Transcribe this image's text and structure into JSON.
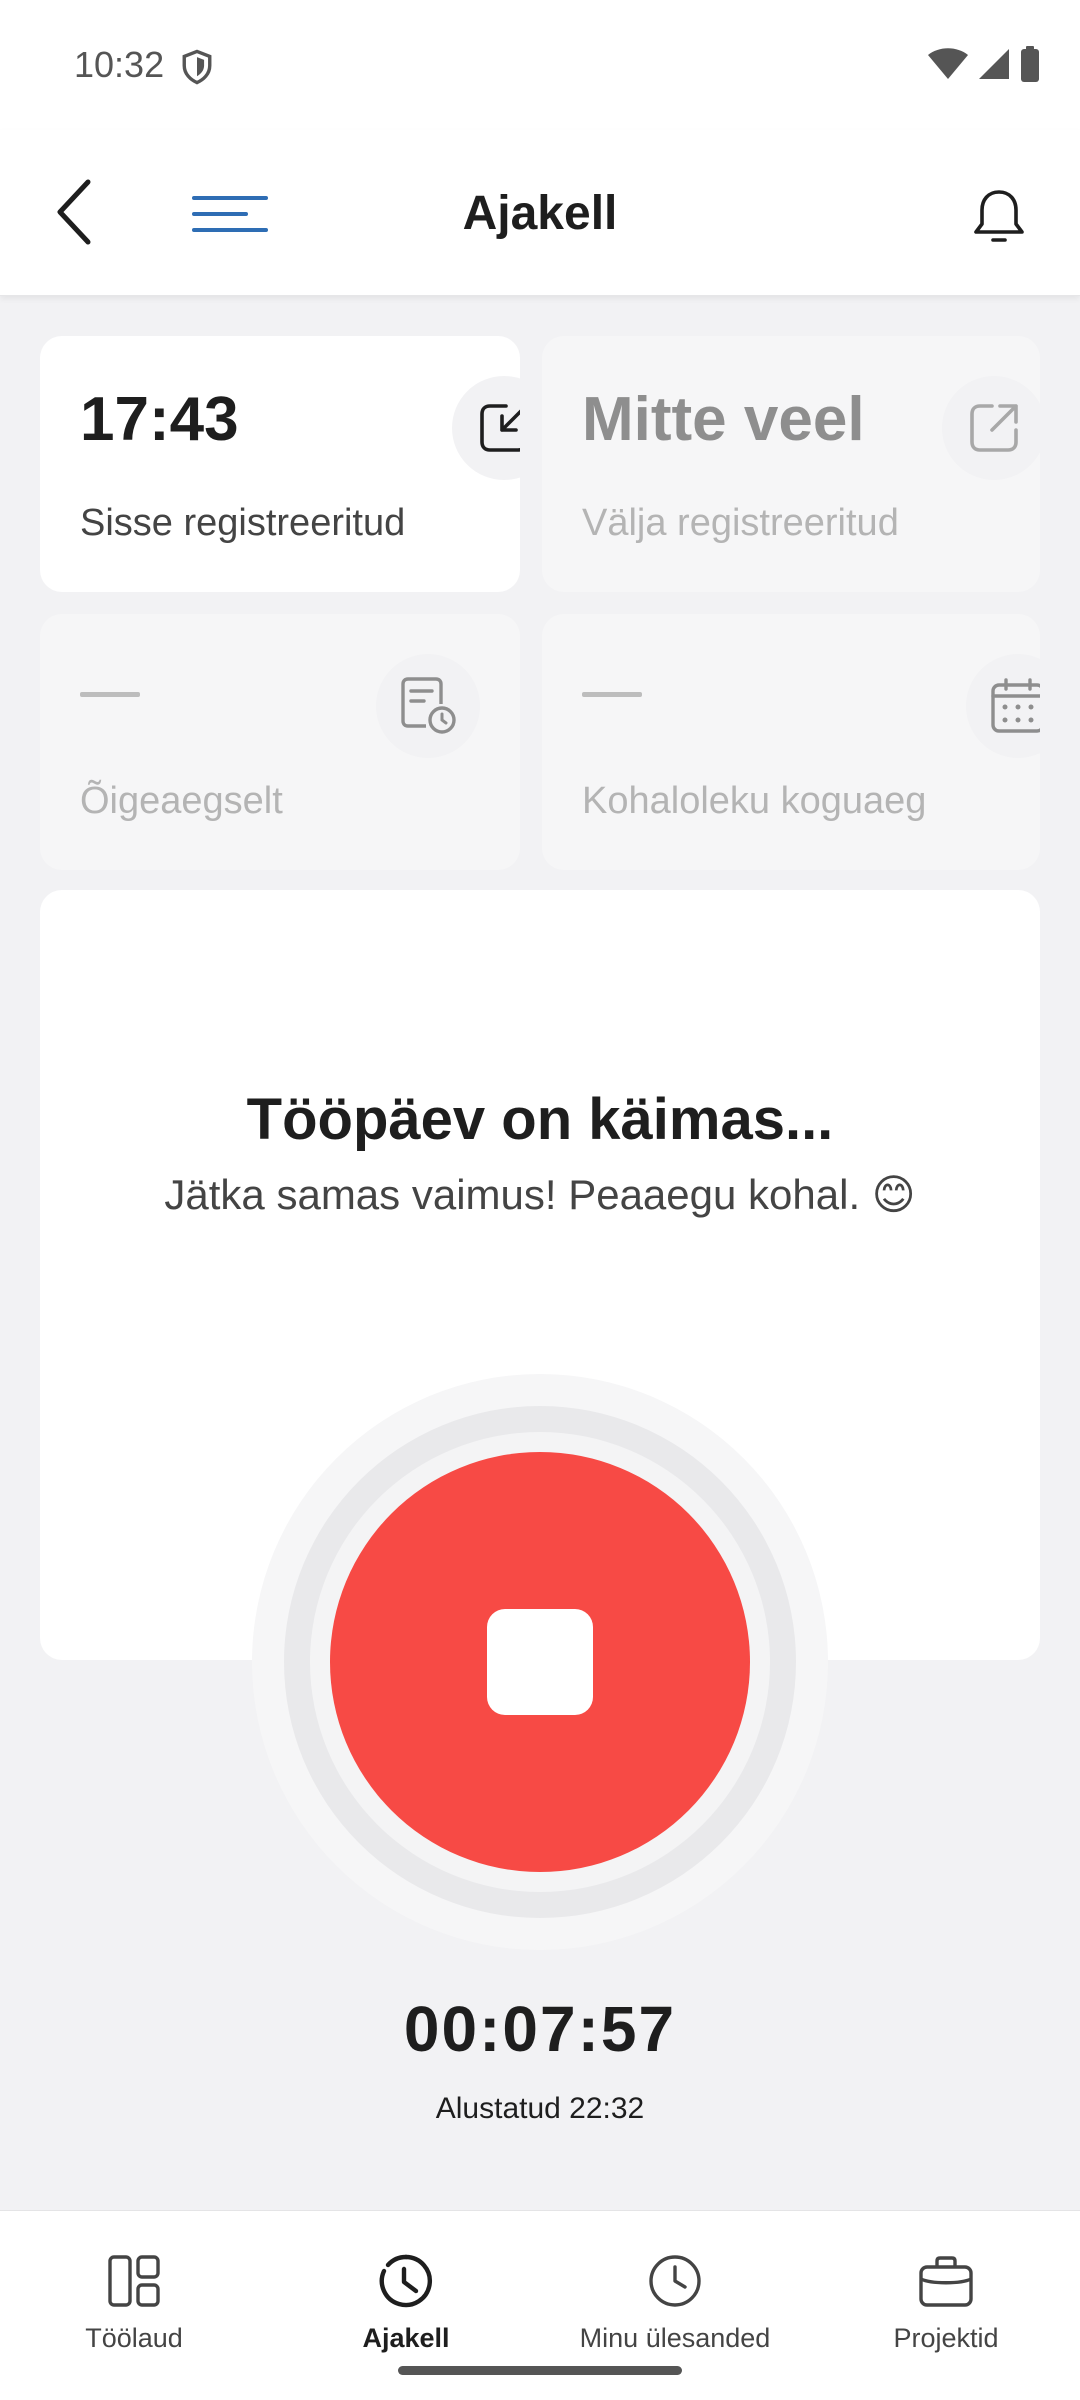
{
  "status_bar": {
    "time": "10:32"
  },
  "header": {
    "title": "Ajakell"
  },
  "cards": {
    "check_in": {
      "value": "17:43",
      "label": "Sisse registreeritud"
    },
    "check_out": {
      "value": "Mitte veel",
      "label": "Välja registreeritud"
    },
    "on_time": {
      "value": "—",
      "label": "Õigeaegselt"
    },
    "total_presence": {
      "value": "—",
      "label": "Kohaloleku koguaeg"
    }
  },
  "main": {
    "title": "Tööpäev on käimas...",
    "subtitle": "Jätka samas vaimus! Peaaegu kohal. 😊"
  },
  "timer": {
    "elapsed": "00:07:57",
    "started": "Alustatud 22:32"
  },
  "bottom_nav": [
    {
      "label": "Töölaud",
      "icon": "dashboard-icon",
      "active": false
    },
    {
      "label": "Ajakell",
      "icon": "clock-icon",
      "active": true
    },
    {
      "label": "Minu ülesanded",
      "icon": "clock-icon",
      "active": false
    },
    {
      "label": "Projektid",
      "icon": "briefcase-icon",
      "active": false
    }
  ],
  "colors": {
    "stop_button": "#F74A45",
    "menu_accent": "#2E6DB4",
    "background": "#F2F2F4"
  }
}
